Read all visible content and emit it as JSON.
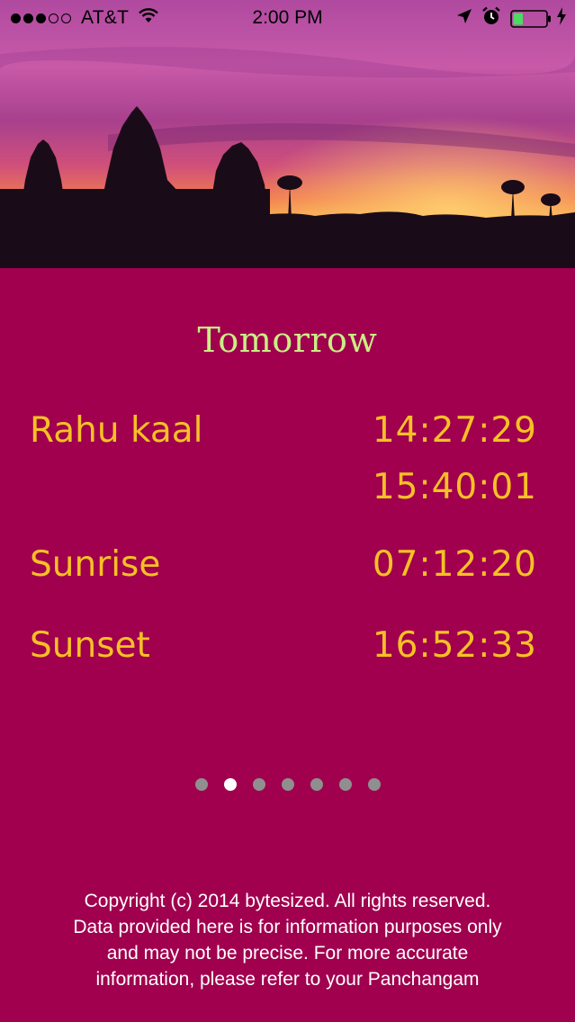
{
  "status_bar": {
    "signal_bars_filled": 3,
    "signal_bars_total": 5,
    "carrier": "AT&T",
    "time": "2:00 PM",
    "battery_level": 0.3,
    "battery_color": "#4cd964"
  },
  "header_image": {
    "description_icon": "temple-silhouette-sunset"
  },
  "page": {
    "title": "Tomorrow"
  },
  "times": {
    "rahu_kaal": {
      "label": "Rahu kaal",
      "start": "14:27:29",
      "end": "15:40:01"
    },
    "sunrise": {
      "label": "Sunrise",
      "value": "07:12:20"
    },
    "sunset": {
      "label": "Sunset",
      "value": "16:52:33"
    }
  },
  "pager": {
    "count": 7,
    "active_index": 1
  },
  "footer": {
    "text": "Copyright (c) 2014 bytesized. All rights reserved.\nData provided here is for information purposes only\nand may not be precise.  For more accurate\ninformation, please refer to your Panchangam"
  },
  "colors": {
    "background": "#a0004e",
    "accent_text": "#f6c025",
    "title_text": "#c9ef85"
  }
}
